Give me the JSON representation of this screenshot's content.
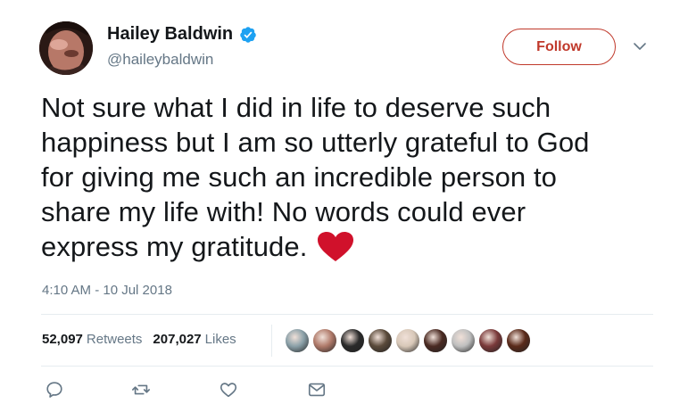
{
  "user": {
    "display_name": "Hailey Baldwin",
    "handle": "@haileybaldwin",
    "verified": true
  },
  "follow_button": {
    "label": "Follow"
  },
  "tweet": {
    "lines": [
      "Not sure what I did in life to deserve such",
      "happiness but I am so utterly grateful to God",
      "for giving me such an incredible person to",
      "share my life with! No words could ever",
      "express my gratitude."
    ],
    "emoji": "heart-emoji",
    "timestamp": "4:10 AM - 10 Jul 2018"
  },
  "stats": {
    "retweets_count": "52,097",
    "retweets_label": "Retweets",
    "likes_count": "207,027",
    "likes_label": "Likes"
  },
  "liker_avatars": [
    {
      "color": "#8aa0a8"
    },
    {
      "color": "#b07a6a"
    },
    {
      "color": "#2a2a2a"
    },
    {
      "color": "#5a4a3a"
    },
    {
      "color": "#d8c8b8"
    },
    {
      "color": "#4a2a22"
    },
    {
      "color": "#bfbfbf"
    },
    {
      "color": "#7a3a3a"
    },
    {
      "color": "#5a2a1a"
    }
  ],
  "actions": [
    "reply-icon",
    "retweet-icon",
    "like-icon",
    "message-icon"
  ],
  "colors": {
    "accent": "#c0392b",
    "verified_blue": "#1da1f2",
    "muted": "#657786",
    "heart": "#d0112b"
  }
}
